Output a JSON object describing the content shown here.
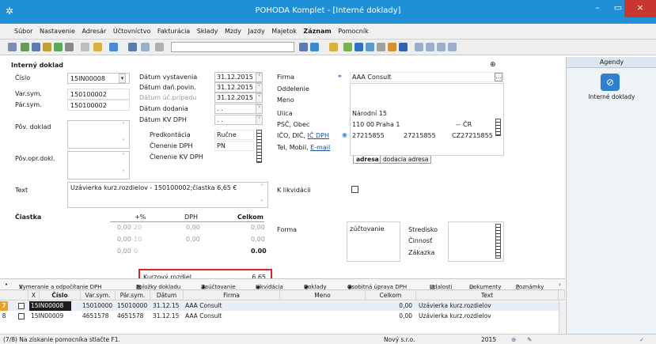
{
  "window": {
    "title": "POHODA Komplet - [Interné doklady]",
    "minimize": "–",
    "maximize": "▭",
    "close": "×"
  },
  "menu": [
    "Súbor",
    "Nastavenie",
    "Adresár",
    "Účtovníctvo",
    "Fakturácia",
    "Sklady",
    "Mzdy",
    "Jazdy",
    "Majetok",
    "Záznam",
    "Pomocník"
  ],
  "form": {
    "heading": "Interný doklad",
    "cislo_label": "Číslo",
    "cislo_value": "15IN00008",
    "varsym_label": "Var.sym.",
    "varsym_value": "150100002",
    "parsym_label": "Pár.sym.",
    "parsym_value": "150100002",
    "povdoklad_label": "Pôv. doklad",
    "povoprdokl_label": "Pôv.opr.dokl.",
    "datum_vystavenia_label": "Dátum vystavenia",
    "datum_vystavenia_value": "31.12.2015",
    "datum_danpovin_label": "Dátum daň.povin.",
    "datum_danpovin_value": "31.12.2015",
    "datum_ucpripadu_label": "Dátum úč.prípadu",
    "datum_ucpripadu_value": "31.12.2015",
    "datum_dodania_label": "Dátum dodania",
    "datum_dodania_value": ". .",
    "datum_kvdph_label": "Dátum KV DPH",
    "datum_kvdph_value": ". .",
    "predkontacia_label": "Predkontácia",
    "predkontacia_value": "Ručne",
    "clenenie_dph_label": "Členenie DPH",
    "clenenie_dph_value": "PN",
    "clenenie_kvdph_label": "Členenie KV DPH",
    "firma_label": "Firma",
    "firma_value": "AAA Consult",
    "oddelenie_label": "Oddelenie",
    "meno_label": "Meno",
    "ulica_label": "Ulica",
    "ulica_value": "Národní 15",
    "psc_label": "PSČ, Obec",
    "psc_value": "110 00",
    "obec_value": "Praha 1",
    "krajina_value": "ČR",
    "krajina_prefix": "--",
    "ico_label": "IČO, DIČ, IČ DPH",
    "ico_prefix": "IČO, DIČ, ",
    "ic_dph_link": "IČ DPH",
    "ico_value": "27215855",
    "dic_value": "27215855",
    "icdph_value": "CZ27215855",
    "tel_label": "Tel, Mobil, E-mail",
    "tel_prefix": "Tel, Mobil, ",
    "email_link": "E-mail",
    "tab_adresa": "adresa",
    "tab_dodacia": "dodacia adresa",
    "text_label": "Text",
    "text_value": "Uzávierka kurz.rozdielov - 150100002;čiastka 6,65 €",
    "k_likvidacii_label": "K likvidácii",
    "ciastka_label": "Čiastka",
    "col_percent": "%",
    "col_dph": "DPH",
    "col_celkom": "Celkom",
    "rows": [
      {
        "base": "0,00",
        "rate": "20",
        "dph": "0,00",
        "celkom": "0,00"
      },
      {
        "base": "0,00",
        "rate": "10",
        "dph": "0,00",
        "celkom": "0,00"
      },
      {
        "base": "0,00",
        "rate": "0",
        "dph": "",
        "celkom": "0,00"
      }
    ],
    "total": "0.00",
    "forma_label": "Forma",
    "forma_value": "zúčtovanie",
    "stredisko_label": "Stredisko",
    "cinnost_label": "Činnosť",
    "zakazka_label": "Zákazka",
    "kurzovy_label": "Kurzový rozdiel",
    "kurzovy_value": "6,65"
  },
  "agenda": {
    "header": "Agendy",
    "item": "Interné doklady"
  },
  "tabs": [
    "Vymeranie a odpočítanie DPH",
    "Položky dokladu",
    "Zaúčtovanie",
    "Likvidácia",
    "Doklady",
    "Osobitná úprava DPH",
    "Udalosti",
    "Dokumenty",
    "Poznámky"
  ],
  "table": {
    "columns": [
      "X",
      "Číslo",
      "Var.sym.",
      "Pár.sym.",
      "Dátum",
      "Firma",
      "Meno",
      "Celkom",
      "Text"
    ],
    "rows": [
      {
        "num": "7",
        "cislo": "15IN00008",
        "varsym": "15010000",
        "parsym": "15010000",
        "datum": "31.12.15",
        "firma": "AAA Consult",
        "meno": "",
        "celkom": "0,00",
        "text": "Uzávierka kurz.rozdielov"
      },
      {
        "num": "8",
        "cislo": "15IN00009",
        "varsym": "4651578",
        "parsym": "4651578",
        "datum": "31.12.15",
        "firma": "AAA Consult",
        "meno": "",
        "celkom": "0,00",
        "text": "Uzávierka kurz.rozdielov"
      }
    ]
  },
  "status": {
    "hint": "(7/8) Na získanie pomocníka stlačte F1.",
    "company": "Nový s.r.o.",
    "year": "2015"
  },
  "colors": {
    "titlebar": "#1f8fd6",
    "close": "#c7372f",
    "highlight_box": "#d9252a",
    "selected_row": "#1c1c1c"
  }
}
